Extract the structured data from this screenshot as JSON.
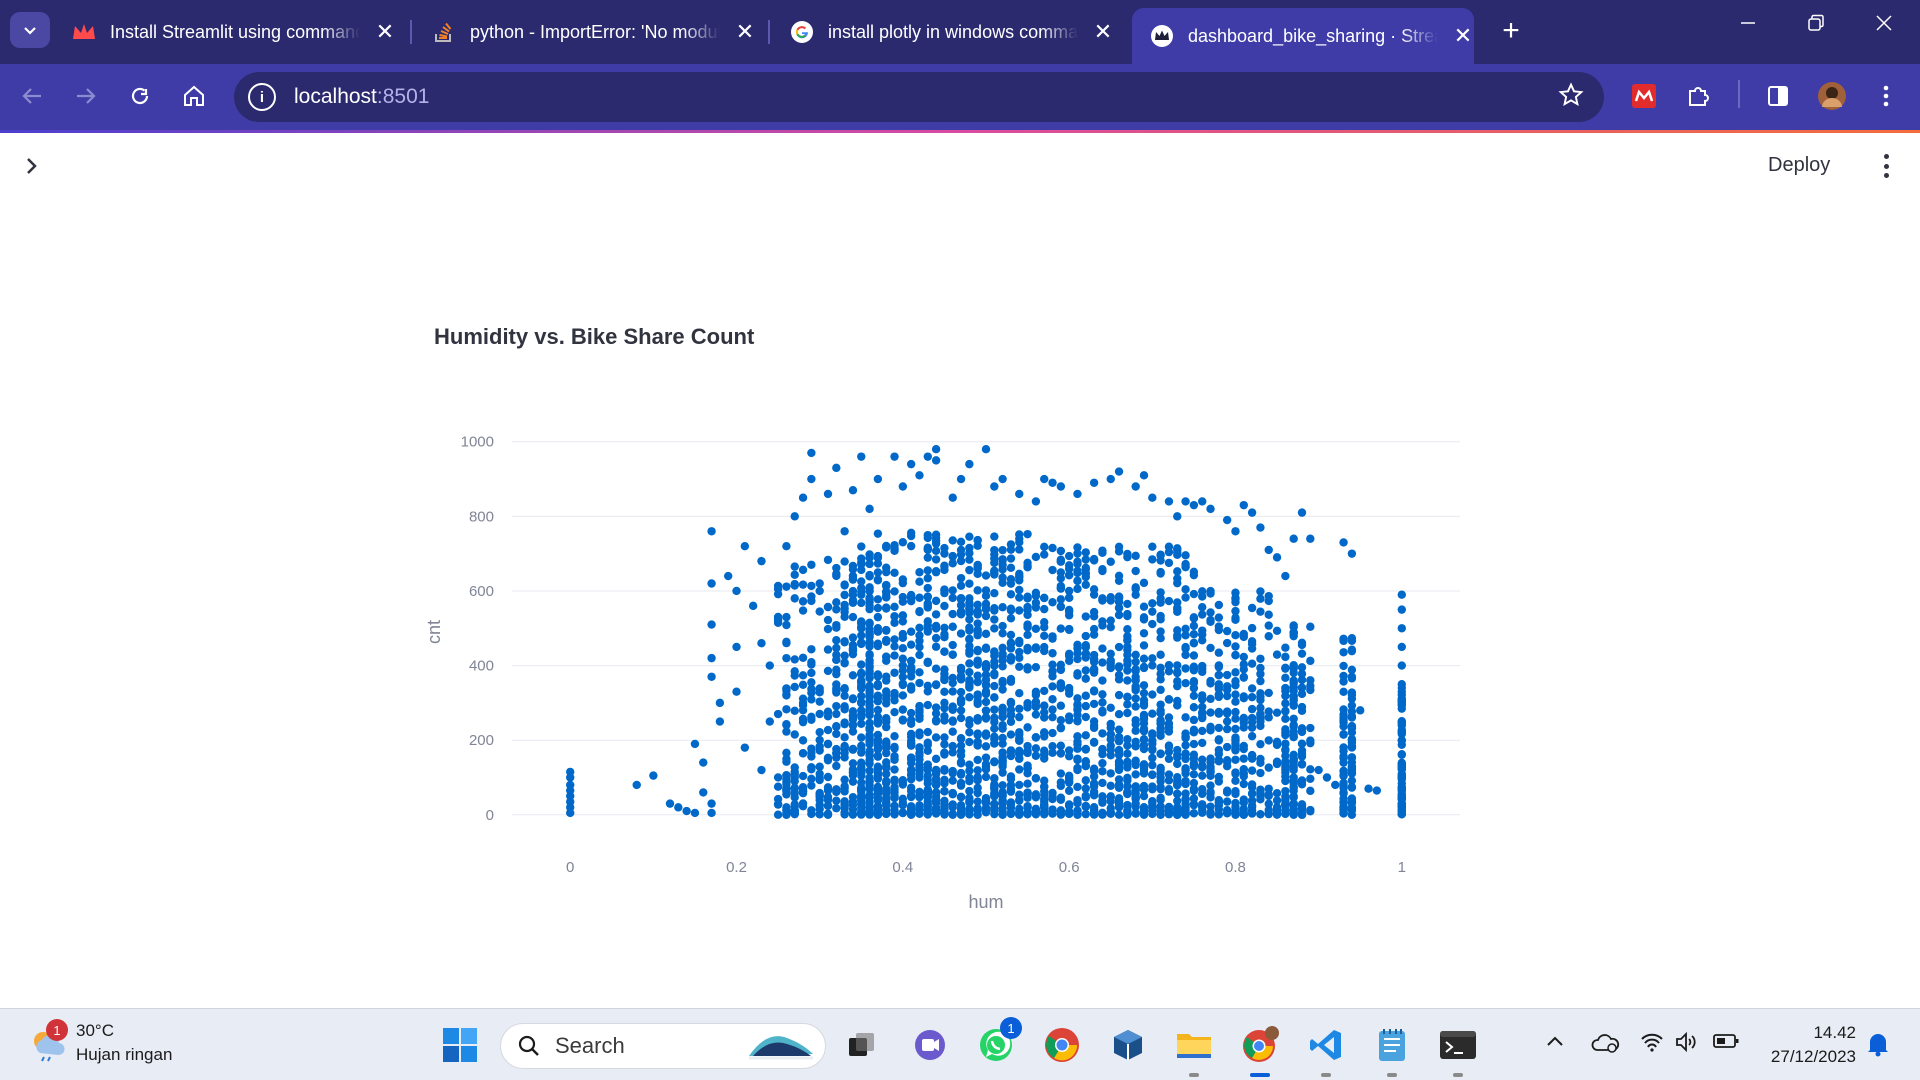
{
  "browser": {
    "tabs": [
      {
        "title": "Install Streamlit using command",
        "icon": "streamlit-crown-icon",
        "active": false
      },
      {
        "title": "python - ImportError: 'No module",
        "icon": "stackoverflow-icon",
        "active": false
      },
      {
        "title": "install plotly in windows command",
        "icon": "google-icon",
        "active": false
      },
      {
        "title": "dashboard_bike_sharing · Streamlit",
        "icon": "streamlit-crown-icon",
        "active": true
      }
    ],
    "close_glyph": "✕",
    "new_tab_glyph": "+",
    "address": {
      "host": "localhost",
      "port": ":8501"
    }
  },
  "streamlit": {
    "deploy_label": "Deploy",
    "chart_title": "Humidity vs. Bike Share Count"
  },
  "chart_data": {
    "type": "scatter",
    "title": "Humidity vs. Bike Share Count",
    "xlabel": "hum",
    "ylabel": "cnt",
    "xlim": [
      -0.07,
      1.07
    ],
    "ylim": [
      -30,
      1010
    ],
    "xticks": [
      0,
      0.2,
      0.4,
      0.6,
      0.8,
      1
    ],
    "xtick_labels": [
      "0",
      "0.2",
      "0.4",
      "0.6",
      "0.8",
      "1"
    ],
    "yticks": [
      0,
      200,
      400,
      600,
      800,
      1000
    ],
    "ytick_labels": [
      "0",
      "200",
      "400",
      "600",
      "800",
      "1000"
    ],
    "color": "#0068c9",
    "grid": true,
    "points": [
      [
        0,
        5
      ],
      [
        0,
        20
      ],
      [
        0,
        35
      ],
      [
        0,
        50
      ],
      [
        0,
        65
      ],
      [
        0,
        80
      ],
      [
        0,
        100
      ],
      [
        0,
        115
      ],
      [
        0.08,
        80
      ],
      [
        0.1,
        105
      ],
      [
        0.12,
        30
      ],
      [
        0.13,
        20
      ],
      [
        0.14,
        10
      ],
      [
        0.15,
        5
      ],
      [
        0.15,
        190
      ],
      [
        0.16,
        60
      ],
      [
        0.16,
        140
      ],
      [
        0.17,
        5
      ],
      [
        0.17,
        30
      ],
      [
        0.17,
        370
      ],
      [
        0.17,
        420
      ],
      [
        0.17,
        510
      ],
      [
        0.17,
        620
      ],
      [
        0.17,
        760
      ],
      [
        0.18,
        250
      ],
      [
        0.18,
        300
      ],
      [
        0.19,
        640
      ],
      [
        0.2,
        330
      ],
      [
        0.2,
        450
      ],
      [
        0.2,
        600
      ],
      [
        0.21,
        180
      ],
      [
        0.21,
        720
      ],
      [
        0.22,
        560
      ],
      [
        0.23,
        120
      ],
      [
        0.23,
        460
      ],
      [
        0.23,
        680
      ],
      [
        0.24,
        250
      ],
      [
        0.24,
        400
      ],
      [
        0.25,
        520
      ],
      [
        0.26,
        720
      ],
      [
        0.26,
        150
      ],
      [
        0.27,
        800
      ],
      [
        0.28,
        850
      ],
      [
        0.28,
        300
      ],
      [
        0.29,
        900
      ],
      [
        0.29,
        970
      ],
      [
        0.3,
        620
      ],
      [
        0.31,
        860
      ],
      [
        0.32,
        930
      ],
      [
        0.33,
        760
      ],
      [
        0.34,
        870
      ],
      [
        0.35,
        960
      ],
      [
        0.36,
        820
      ],
      [
        0.37,
        900
      ],
      [
        0.39,
        960
      ],
      [
        0.4,
        880
      ],
      [
        0.41,
        940
      ],
      [
        0.42,
        910
      ],
      [
        0.43,
        960
      ],
      [
        0.44,
        950
      ],
      [
        0.44,
        980
      ],
      [
        0.46,
        850
      ],
      [
        0.47,
        900
      ],
      [
        0.48,
        940
      ],
      [
        0.5,
        980
      ],
      [
        0.51,
        880
      ],
      [
        0.52,
        900
      ],
      [
        0.54,
        860
      ],
      [
        0.56,
        840
      ],
      [
        0.57,
        900
      ],
      [
        0.58,
        890
      ],
      [
        0.59,
        880
      ],
      [
        0.61,
        860
      ],
      [
        0.63,
        890
      ],
      [
        0.65,
        900
      ],
      [
        0.66,
        920
      ],
      [
        0.68,
        880
      ],
      [
        0.69,
        910
      ],
      [
        0.7,
        850
      ],
      [
        0.72,
        840
      ],
      [
        0.73,
        800
      ],
      [
        0.74,
        840
      ],
      [
        0.75,
        830
      ],
      [
        0.76,
        840
      ],
      [
        0.77,
        820
      ],
      [
        0.79,
        790
      ],
      [
        0.8,
        760
      ],
      [
        0.81,
        830
      ],
      [
        0.82,
        810
      ],
      [
        0.83,
        770
      ],
      [
        0.84,
        710
      ],
      [
        0.85,
        690
      ],
      [
        0.86,
        640
      ],
      [
        0.87,
        740
      ],
      [
        0.88,
        810
      ],
      [
        0.89,
        740
      ],
      [
        0.9,
        120
      ],
      [
        0.91,
        100
      ],
      [
        0.92,
        80
      ],
      [
        0.93,
        730
      ],
      [
        0.94,
        700
      ],
      [
        0.95,
        280
      ],
      [
        0.96,
        70
      ],
      [
        0.97,
        65
      ],
      [
        1,
        590
      ],
      [
        1,
        550
      ],
      [
        1,
        500
      ],
      [
        1,
        450
      ],
      [
        1,
        400
      ],
      [
        1,
        350
      ]
    ],
    "density_clusters": [
      {
        "x_range": [
          0.25,
          0.37
        ],
        "y_range": [
          0,
          700
        ],
        "n": 380
      },
      {
        "x_range": [
          0.35,
          0.55
        ],
        "y_range": [
          0,
          760
        ],
        "n": 900
      },
      {
        "x_range": [
          0.55,
          0.75
        ],
        "y_range": [
          0,
          720
        ],
        "n": 720
      },
      {
        "x_range": [
          0.75,
          0.84
        ],
        "y_range": [
          0,
          600
        ],
        "n": 280
      },
      {
        "x_range": [
          0.85,
          0.89
        ],
        "y_range": [
          0,
          520
        ],
        "n": 160
      },
      {
        "x_range": [
          0.93,
          0.94
        ],
        "y_range": [
          0,
          480
        ],
        "n": 90
      },
      {
        "x_range": [
          1.0,
          1.0
        ],
        "y_range": [
          0,
          350
        ],
        "n": 70
      }
    ]
  },
  "taskbar": {
    "weather_badge": "1",
    "temperature": "30°C",
    "condition": "Hujan ringan",
    "search_placeholder": "Search",
    "whatsapp_badge": "1",
    "time": "14.42",
    "date": "27/12/2023"
  }
}
